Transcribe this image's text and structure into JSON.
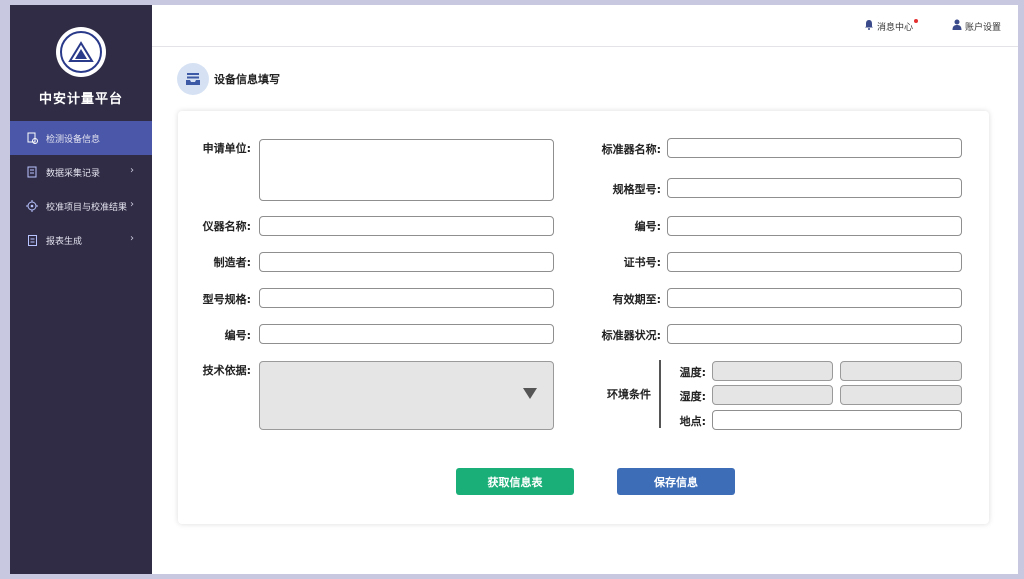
{
  "brand": {
    "name": "中安计量平台"
  },
  "sidebar": {
    "items": [
      {
        "label": "检测设备信息",
        "icon": "device-check-icon",
        "active": true
      },
      {
        "label": "数据采集记录",
        "icon": "data-record-icon"
      },
      {
        "label": "校准项目与校准结果",
        "icon": "target-icon"
      },
      {
        "label": "报表生成",
        "icon": "report-icon"
      }
    ]
  },
  "topbar": {
    "messages": "消息中心",
    "account": "账户设置"
  },
  "section": {
    "title": "设备信息填写",
    "icon": "inbox-icon"
  },
  "form": {
    "left": {
      "applicant": "申请单位:",
      "instrument_name": "仪器名称:",
      "manufacturer": "制造者:",
      "model": "型号规格:",
      "serial": "编号:",
      "basis": "技术依据:"
    },
    "right": {
      "std_name": "标准器名称:",
      "spec_model": "规格型号:",
      "serial": "编号:",
      "cert_no": "证书号:",
      "valid_until": "有效期至:",
      "std_status": "标准器状况:",
      "env": "环境条件",
      "temp": "温度:",
      "humidity": "湿度:",
      "location": "地点:"
    }
  },
  "buttons": {
    "fetch": "获取信息表",
    "save": "保存信息"
  },
  "colors": {
    "sidebar": "#302c45",
    "active": "#4b58a9",
    "fetch": "#1aaf78",
    "save": "#3d6db7"
  }
}
